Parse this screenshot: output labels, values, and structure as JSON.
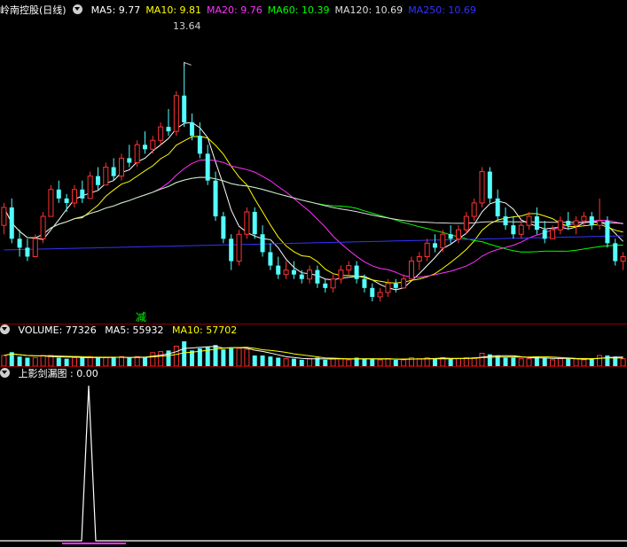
{
  "main": {
    "stock_title": "岭南控股(日线)",
    "ma": [
      {
        "label": "MA5: 9.77",
        "color": "#ffffff"
      },
      {
        "label": "MA10: 9.81",
        "color": "#ffff00"
      },
      {
        "label": "MA20: 9.76",
        "color": "#ff33ff"
      },
      {
        "label": "MA60: 10.39",
        "color": "#00ff00"
      },
      {
        "label": "MA120: 10.69",
        "color": "#dddddd"
      },
      {
        "label": "MA250: 10.69",
        "color": "#3333ff"
      }
    ],
    "high_label": "13.64",
    "signal_label": "减"
  },
  "volume": {
    "title": "VOLUME: 77326",
    "ma5": "MA5: 55932",
    "ma10": "MA10: 57702"
  },
  "indicator": {
    "title": "上影剑漏图 : 0.00"
  },
  "chart_data": {
    "type": "candlestick",
    "price_range": [
      8.2,
      14.6
    ],
    "candles": [
      [
        10.0,
        10.5,
        9.8,
        10.4
      ],
      [
        10.4,
        10.6,
        9.6,
        9.7
      ],
      [
        9.7,
        9.9,
        9.3,
        9.5
      ],
      [
        9.5,
        9.7,
        9.2,
        9.3
      ],
      [
        9.3,
        9.8,
        9.3,
        9.7
      ],
      [
        9.7,
        10.3,
        9.6,
        10.2
      ],
      [
        10.2,
        10.9,
        10.2,
        10.8
      ],
      [
        10.8,
        11.0,
        10.5,
        10.6
      ],
      [
        10.6,
        10.7,
        10.3,
        10.5
      ],
      [
        10.5,
        10.9,
        10.4,
        10.8
      ],
      [
        10.8,
        11.0,
        10.5,
        10.6
      ],
      [
        10.6,
        11.2,
        10.6,
        11.1
      ],
      [
        11.1,
        11.3,
        10.8,
        10.9
      ],
      [
        10.9,
        11.4,
        10.9,
        11.3
      ],
      [
        11.3,
        11.5,
        11.0,
        11.1
      ],
      [
        11.1,
        11.6,
        11.0,
        11.5
      ],
      [
        11.5,
        11.8,
        11.3,
        11.4
      ],
      [
        11.4,
        11.9,
        11.3,
        11.8
      ],
      [
        11.8,
        12.1,
        11.6,
        11.7
      ],
      [
        11.7,
        12.0,
        11.6,
        11.9
      ],
      [
        11.9,
        12.3,
        11.8,
        12.2
      ],
      [
        12.2,
        12.6,
        12.0,
        12.1
      ],
      [
        12.1,
        13.0,
        12.0,
        12.9
      ],
      [
        12.9,
        13.64,
        12.2,
        12.3
      ],
      [
        12.3,
        12.5,
        11.9,
        12.0
      ],
      [
        12.0,
        12.3,
        11.5,
        11.6
      ],
      [
        11.6,
        11.8,
        10.9,
        11.0
      ],
      [
        11.0,
        11.2,
        10.1,
        10.2
      ],
      [
        10.2,
        10.3,
        9.6,
        9.7
      ],
      [
        9.7,
        9.8,
        9.0,
        9.2
      ],
      [
        9.2,
        9.9,
        9.1,
        9.8
      ],
      [
        9.8,
        10.4,
        9.7,
        10.3
      ],
      [
        10.3,
        10.4,
        9.7,
        9.8
      ],
      [
        9.8,
        10.0,
        9.3,
        9.4
      ],
      [
        9.4,
        9.6,
        9.0,
        9.1
      ],
      [
        9.1,
        9.3,
        8.8,
        8.9
      ],
      [
        8.9,
        9.2,
        8.8,
        9.0
      ],
      [
        9.0,
        9.2,
        8.8,
        8.9
      ],
      [
        8.9,
        9.0,
        8.7,
        8.8
      ],
      [
        8.8,
        9.1,
        8.7,
        9.0
      ],
      [
        9.0,
        9.1,
        8.6,
        8.7
      ],
      [
        8.7,
        8.8,
        8.5,
        8.6
      ],
      [
        8.6,
        8.9,
        8.5,
        8.8
      ],
      [
        8.8,
        9.1,
        8.7,
        9.0
      ],
      [
        9.0,
        9.2,
        8.9,
        9.1
      ],
      [
        9.1,
        9.2,
        8.7,
        8.8
      ],
      [
        8.8,
        8.9,
        8.5,
        8.6
      ],
      [
        8.6,
        8.7,
        8.3,
        8.4
      ],
      [
        8.4,
        8.6,
        8.3,
        8.5
      ],
      [
        8.5,
        8.8,
        8.4,
        8.7
      ],
      [
        8.7,
        8.8,
        8.5,
        8.6
      ],
      [
        8.6,
        8.9,
        8.6,
        8.8
      ],
      [
        8.8,
        9.3,
        8.8,
        9.2
      ],
      [
        9.2,
        9.4,
        9.0,
        9.3
      ],
      [
        9.3,
        9.7,
        9.2,
        9.6
      ],
      [
        9.6,
        9.8,
        9.4,
        9.5
      ],
      [
        9.5,
        9.9,
        9.4,
        9.8
      ],
      [
        9.8,
        10.0,
        9.6,
        9.7
      ],
      [
        9.7,
        10.0,
        9.6,
        9.9
      ],
      [
        9.9,
        10.3,
        9.8,
        10.2
      ],
      [
        10.2,
        10.6,
        10.1,
        10.5
      ],
      [
        10.5,
        11.3,
        10.4,
        11.2
      ],
      [
        11.2,
        11.3,
        10.5,
        10.6
      ],
      [
        10.6,
        10.8,
        10.1,
        10.2
      ],
      [
        10.2,
        10.4,
        9.9,
        10.0
      ],
      [
        10.0,
        10.2,
        9.7,
        9.8
      ],
      [
        9.8,
        10.1,
        9.7,
        10.0
      ],
      [
        10.0,
        10.3,
        9.9,
        10.2
      ],
      [
        10.2,
        10.4,
        9.8,
        9.9
      ],
      [
        9.9,
        10.1,
        9.6,
        9.7
      ],
      [
        9.7,
        10.0,
        9.7,
        9.9
      ],
      [
        9.9,
        10.2,
        9.8,
        10.1
      ],
      [
        10.1,
        10.3,
        9.9,
        10.0
      ],
      [
        10.0,
        10.2,
        9.8,
        10.1
      ],
      [
        10.1,
        10.3,
        10.0,
        10.2
      ],
      [
        10.2,
        10.3,
        9.9,
        10.0
      ],
      [
        10.0,
        10.6,
        9.9,
        10.1
      ],
      [
        10.1,
        10.2,
        9.5,
        9.6
      ],
      [
        9.6,
        9.7,
        9.1,
        9.2
      ],
      [
        9.2,
        9.4,
        9.0,
        9.3
      ]
    ],
    "spike_index": 22
  }
}
